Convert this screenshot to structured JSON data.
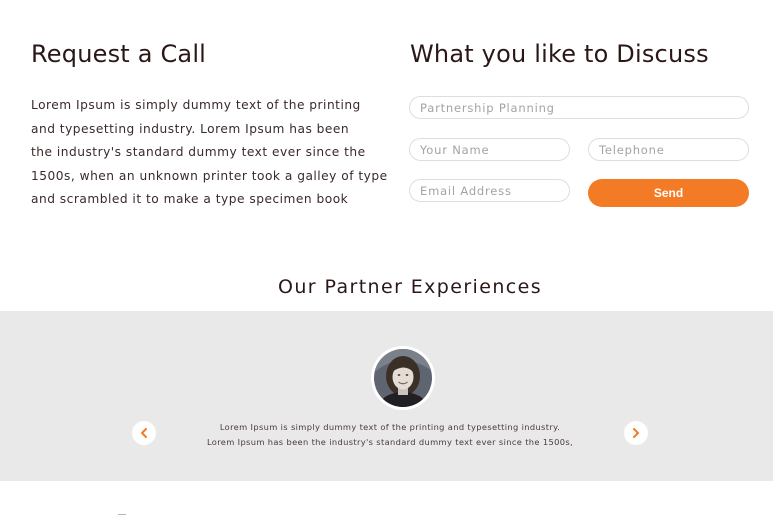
{
  "request_call": {
    "title": "Request a Call",
    "lines": [
      "Lorem Ipsum is simply dummy text of the printing",
      "and typesetting industry. Lorem Ipsum has been",
      "the industry's standard dummy text ever since the",
      "1500s, when an unknown printer took a galley of type",
      "and scrambled it to make a type specimen book"
    ]
  },
  "discuss": {
    "title": "What you like to Discuss",
    "fields": {
      "topic_placeholder": "Partnership Planning",
      "name_placeholder": "Your Name",
      "telephone_placeholder": "Telephone",
      "email_placeholder": "Email Address"
    },
    "send_label": "Send"
  },
  "partners": {
    "title": "Our Partner Experiences",
    "quote_lines": [
      "Lorem Ipsum is simply dummy text of the printing and typesetting industry.",
      "Lorem Ipsum has been the industry's standard dummy text ever since the 1500s,"
    ],
    "prev_icon": "chevron-left-icon",
    "next_icon": "chevron-right-icon"
  },
  "colors": {
    "accent": "#f47b25",
    "band_bg": "#e9e9e9",
    "heading": "#2b1717"
  }
}
